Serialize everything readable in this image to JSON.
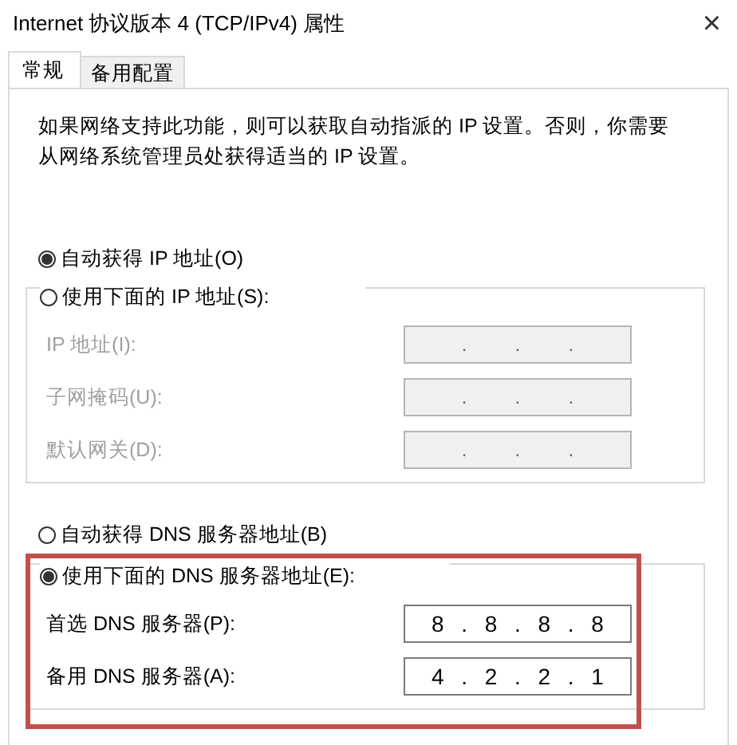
{
  "window": {
    "title": "Internet 协议版本 4 (TCP/IPv4) 属性",
    "close": "×"
  },
  "tabs": [
    {
      "label": "常规",
      "selected": true
    },
    {
      "label": "备用配置",
      "selected": false
    }
  ],
  "description": "如果网络支持此功能，则可以获取自动指派的 IP 设置。否则，你需要从网络系统管理员处获得适当的 IP 设置。",
  "ip": {
    "auto_option": {
      "label": "自动获得 IP 地址(O)",
      "selected": true
    },
    "manual_option": {
      "label": "使用下面的 IP 地址(S):",
      "selected": false
    },
    "fields": [
      {
        "label": "IP 地址(I):",
        "disabled": true,
        "separators": [
          ".",
          ".",
          "."
        ]
      },
      {
        "label": "子网掩码(U):",
        "disabled": true,
        "separators": [
          ".",
          ".",
          "."
        ]
      },
      {
        "label": "默认网关(D):",
        "disabled": true,
        "separators": [
          ".",
          ".",
          "."
        ]
      }
    ]
  },
  "dns": {
    "auto_option": {
      "label": "自动获得 DNS 服务器地址(B)",
      "selected": false
    },
    "manual_option": {
      "label": "使用下面的 DNS 服务器地址(E):",
      "selected": true
    },
    "fields": [
      {
        "label": "首选 DNS 服务器(P):",
        "disabled": false,
        "octets": [
          "8",
          "8",
          "8",
          "8"
        ],
        "separators": [
          ".",
          ".",
          "."
        ]
      },
      {
        "label": "备用 DNS 服务器(A):",
        "disabled": false,
        "octets": [
          "4",
          "2",
          "2",
          "1"
        ],
        "separators": [
          ".",
          ".",
          "."
        ]
      }
    ]
  }
}
